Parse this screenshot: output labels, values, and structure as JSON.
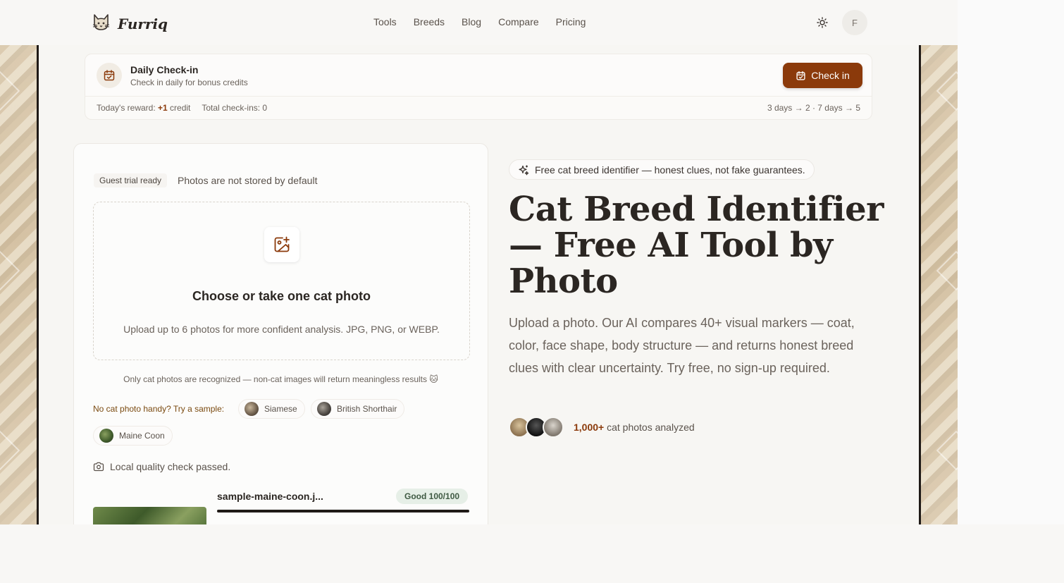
{
  "nav": {
    "brand": "Furriq",
    "links": [
      "Tools",
      "Breeds",
      "Blog",
      "Compare",
      "Pricing"
    ],
    "avatar_initial": "F"
  },
  "checkin": {
    "title": "Daily Check-in",
    "subtitle": "Check in daily for bonus credits",
    "button": "Check in",
    "reward_prefix": "Today's reward: ",
    "reward_value": "+1",
    "reward_suffix": " credit",
    "total": "Total check-ins: 0",
    "streak": "3 days → 2 · 7 days → 5"
  },
  "upload": {
    "badge": "Guest trial ready",
    "privacy": "Photos are not stored by default",
    "title": "Choose or take one cat photo",
    "subtitle": "Upload up to 6 photos for more confident analysis. JPG, PNG, or WEBP.",
    "warning": "Only cat photos are recognized — non-cat images will return meaningless results 🐱",
    "sample_label": "No cat photo handy? Try a sample:",
    "samples": [
      "Siamese",
      "British Shorthair",
      "Maine Coon"
    ],
    "quality_check": "Local quality check passed.",
    "file_name": "sample-maine-coon.j...",
    "file_score": "Good 100/100",
    "file_progress": 1.0
  },
  "hero": {
    "pill": "Free cat breed identifier — honest clues, not fake guarantees.",
    "title": "Cat Breed Identifier — Free AI Tool by Photo",
    "description": "Upload a photo. Our AI compares 40+ visual markers — coat, color, face shape, body structure — and returns honest breed clues with clear uncertainty. Try free, no sign-up required.",
    "social_count": "1,000+",
    "social_text": " cat photos analyzed"
  },
  "colors": {
    "accent": "#8b3a0b",
    "background": "#f7f6f3",
    "text": "#2b2622"
  }
}
